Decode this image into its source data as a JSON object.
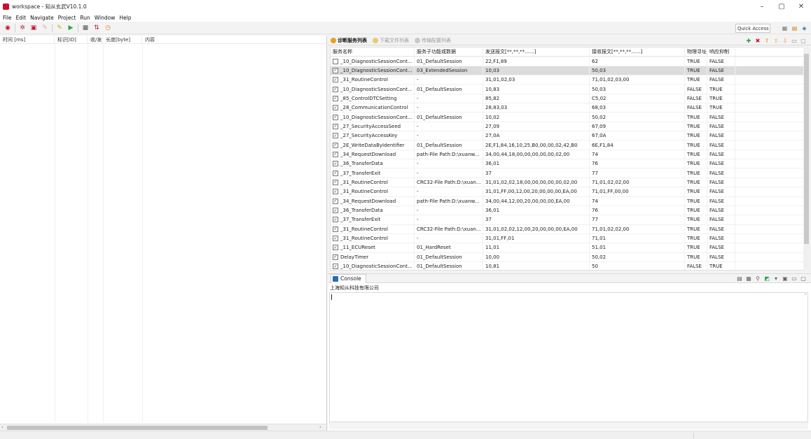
{
  "window": {
    "title": "workspace - 知从玄武V10.1.0",
    "minimize": "–",
    "maximize": "▢",
    "close": "✕"
  },
  "menu": [
    "File",
    "Edit",
    "Navigate",
    "Project",
    "Run",
    "Window",
    "Help"
  ],
  "toolbar": {
    "quick_access": "Quick Access"
  },
  "left_panel": {
    "columns": [
      "时间 [ms]",
      "标识[ID]",
      "收/发",
      "长度[byte]",
      "内容"
    ]
  },
  "right_tabs": {
    "tabs": [
      "诊断服务列表",
      "下载文件列表",
      "传输配置列表"
    ],
    "active": 0
  },
  "service_table": {
    "headers": [
      "服务名称",
      "服务子功能或数据",
      "发送报文[**,**,**......]",
      "接收报文[**,**,**......]",
      "物理寻址",
      "响应抑制"
    ],
    "rows": [
      {
        "checked": false,
        "name": "_10_DiagnosticSessionCont...",
        "sub": "01_DefaultSession",
        "send": "22,F1,89",
        "recv": "62",
        "phys": "TRUE",
        "supp": "FALSE",
        "selected": false
      },
      {
        "checked": true,
        "name": "_10_DiagnosticSessionCont...",
        "sub": "03_ExtendedSession",
        "send": "10,03",
        "recv": "50,03",
        "phys": "TRUE",
        "supp": "FALSE",
        "selected": true
      },
      {
        "checked": true,
        "name": "_31_RoutineControl",
        "sub": "-",
        "send": "31,01,02,03",
        "recv": "71,01,02,03,00",
        "phys": "TRUE",
        "supp": "FALSE",
        "selected": false
      },
      {
        "checked": true,
        "name": "_10_DiagnosticSessionCont...",
        "sub": "01_DefaultSession",
        "send": "10,83",
        "recv": "50,03",
        "phys": "FALSE",
        "supp": "TRUE",
        "selected": false
      },
      {
        "checked": true,
        "name": "_85_ControlDTCSetting",
        "sub": "-",
        "send": "85,82",
        "recv": "C5,02",
        "phys": "FALSE",
        "supp": "TRUE",
        "selected": false
      },
      {
        "checked": true,
        "name": "_28_CommunicationControl",
        "sub": "-",
        "send": "28,83,03",
        "recv": "68,03",
        "phys": "FALSE",
        "supp": "TRUE",
        "selected": false
      },
      {
        "checked": true,
        "name": "_10_DiagnosticSessionCont...",
        "sub": "01_DefaultSession",
        "send": "10,02",
        "recv": "50,02",
        "phys": "TRUE",
        "supp": "FALSE",
        "selected": false
      },
      {
        "checked": true,
        "name": "_27_SecurityAccessSeed",
        "sub": "-",
        "send": "27,09",
        "recv": "67,09",
        "phys": "TRUE",
        "supp": "FALSE",
        "selected": false
      },
      {
        "checked": true,
        "name": "_27_SecurityAccessKey",
        "sub": "-",
        "send": "27,0A",
        "recv": "67,0A",
        "phys": "TRUE",
        "supp": "FALSE",
        "selected": false
      },
      {
        "checked": true,
        "name": "_2E_WriteDataByIdentifier",
        "sub": "01_DefaultSession",
        "send": "2E,F1,84,16,10,25,B0,00,00,02,42,B0",
        "recv": "6E,F1,84",
        "phys": "TRUE",
        "supp": "FALSE",
        "selected": false
      },
      {
        "checked": true,
        "name": "_34_RequestDownload",
        "sub": "path-File Path:D:\\xuanw...",
        "send": "34,00,44,18,00,00,00,00,00,02,00",
        "recv": "74",
        "phys": "TRUE",
        "supp": "FALSE",
        "selected": false
      },
      {
        "checked": true,
        "name": "_36_TransferData",
        "sub": "-",
        "send": "36,01",
        "recv": "76",
        "phys": "TRUE",
        "supp": "FALSE",
        "selected": false
      },
      {
        "checked": true,
        "name": "_37_TransferExit",
        "sub": "-",
        "send": "37",
        "recv": "77",
        "phys": "TRUE",
        "supp": "FALSE",
        "selected": false
      },
      {
        "checked": true,
        "name": "_31_RoutineControl",
        "sub": "CRC32-File Path:D:\\xuan...",
        "send": "31,01,02,02,18,00,00,00,00,00,02,00",
        "recv": "71,01,02,02,00",
        "phys": "TRUE",
        "supp": "FALSE",
        "selected": false
      },
      {
        "checked": true,
        "name": "_31_RoutineControl",
        "sub": "-",
        "send": "31,01,FF,00,12,00,20,00,00,00,EA,00",
        "recv": "71,01,FF,00,00",
        "phys": "TRUE",
        "supp": "FALSE",
        "selected": false
      },
      {
        "checked": true,
        "name": "_34_RequestDownload",
        "sub": "path-File Path:D:\\xuanw...",
        "send": "34,00,44,12,00,20,00,00,00,EA,00",
        "recv": "74",
        "phys": "TRUE",
        "supp": "FALSE",
        "selected": false
      },
      {
        "checked": true,
        "name": "_36_TransferData",
        "sub": "-",
        "send": "36,01",
        "recv": "76",
        "phys": "TRUE",
        "supp": "FALSE",
        "selected": false
      },
      {
        "checked": true,
        "name": "_37_TransferExit",
        "sub": "-",
        "send": "37",
        "recv": "77",
        "phys": "TRUE",
        "supp": "FALSE",
        "selected": false
      },
      {
        "checked": true,
        "name": "_31_RoutineControl",
        "sub": "CRC32-File Path:D:\\xuan...",
        "send": "31,01,02,02,12,00,20,00,00,00,EA,00",
        "recv": "71,01,02,02,00",
        "phys": "TRUE",
        "supp": "FALSE",
        "selected": false
      },
      {
        "checked": true,
        "name": "_31_RoutineControl",
        "sub": "-",
        "send": "31,01,FF,01",
        "recv": "71,01",
        "phys": "TRUE",
        "supp": "FALSE",
        "selected": false
      },
      {
        "checked": true,
        "name": "_11_ECUReset",
        "sub": "01_HardReset",
        "send": "11,01",
        "recv": "51,01",
        "phys": "TRUE",
        "supp": "FALSE",
        "selected": false
      },
      {
        "checked": true,
        "name": "DelayTimer",
        "sub": "01_DefaultSession",
        "send": "10,00",
        "recv": "50,02",
        "phys": "TRUE",
        "supp": "FALSE",
        "selected": false
      },
      {
        "checked": true,
        "name": "_10_DiagnosticSessionCont...",
        "sub": "01_DefaultSession",
        "send": "10,81",
        "recv": "50",
        "phys": "FALSE",
        "supp": "TRUE",
        "selected": false
      }
    ]
  },
  "console": {
    "tab_label": "Console",
    "label": "上海知从科技有限公司"
  },
  "colors": {
    "accent_red": "#c8102e",
    "selection": "#dcdcdc"
  }
}
